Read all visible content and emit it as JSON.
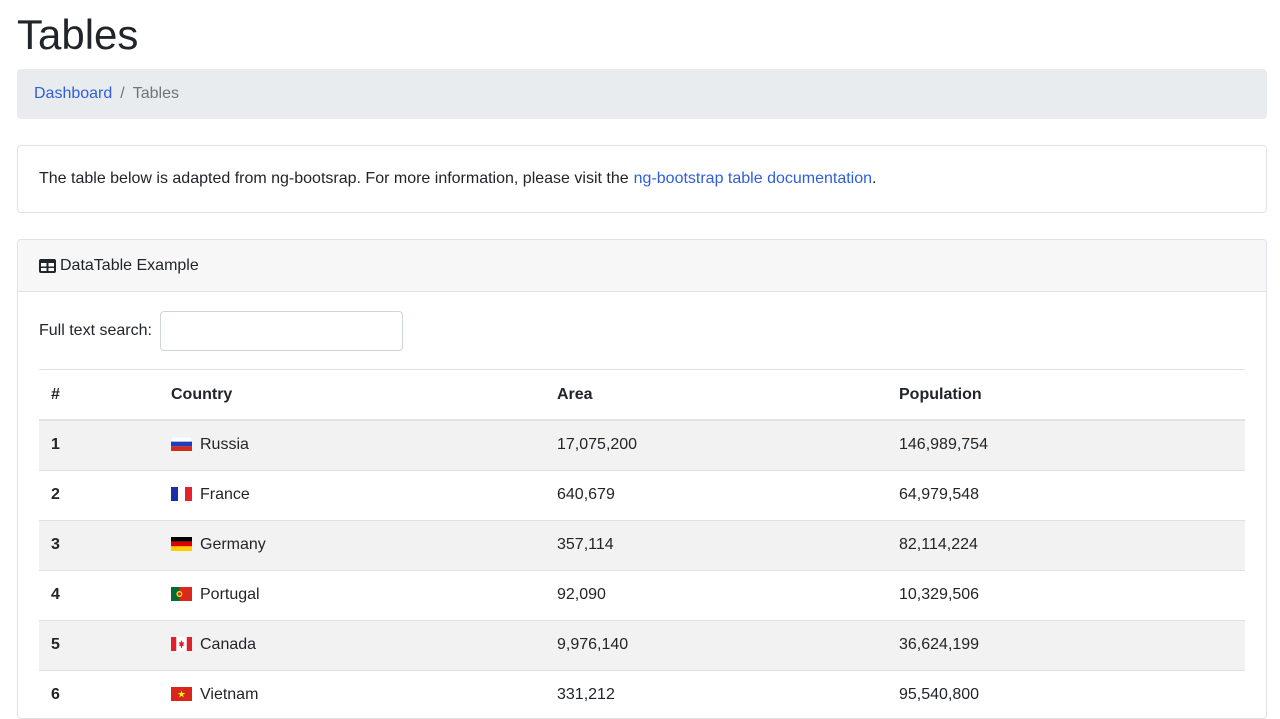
{
  "page": {
    "title": "Tables"
  },
  "breadcrumb": {
    "home": "Dashboard",
    "separator": "/",
    "current": "Tables"
  },
  "info": {
    "text": "The table below is adapted from ng-bootsrap. For more information, please visit the",
    "link_text": "ng-bootstrap table documentation",
    "suffix": "."
  },
  "card": {
    "icon": "table-icon",
    "title": "DataTable Example",
    "search_label": "Full text search:",
    "search_value": ""
  },
  "table": {
    "headers": [
      "#",
      "Country",
      "Area",
      "Population"
    ],
    "rows": [
      {
        "num": "1",
        "country": "Russia",
        "flag": "russia-flag-icon",
        "area": "17,075,200",
        "population": "146,989,754"
      },
      {
        "num": "2",
        "country": "France",
        "flag": "france-flag-icon",
        "area": "640,679",
        "population": "64,979,548"
      },
      {
        "num": "3",
        "country": "Germany",
        "flag": "germany-flag-icon",
        "area": "357,114",
        "population": "82,114,224"
      },
      {
        "num": "4",
        "country": "Portugal",
        "flag": "portugal-flag-icon",
        "area": "92,090",
        "population": "10,329,506"
      },
      {
        "num": "5",
        "country": "Canada",
        "flag": "canada-flag-icon",
        "area": "9,976,140",
        "population": "36,624,199"
      },
      {
        "num": "6",
        "country": "Vietnam",
        "flag": "vietnam-flag-icon",
        "area": "331,212",
        "population": "95,540,800"
      }
    ]
  },
  "colors": {
    "link": "#2f5fd8",
    "breadcrumb_bg": "#e9ecef",
    "stripe": "#f2f2f2"
  }
}
